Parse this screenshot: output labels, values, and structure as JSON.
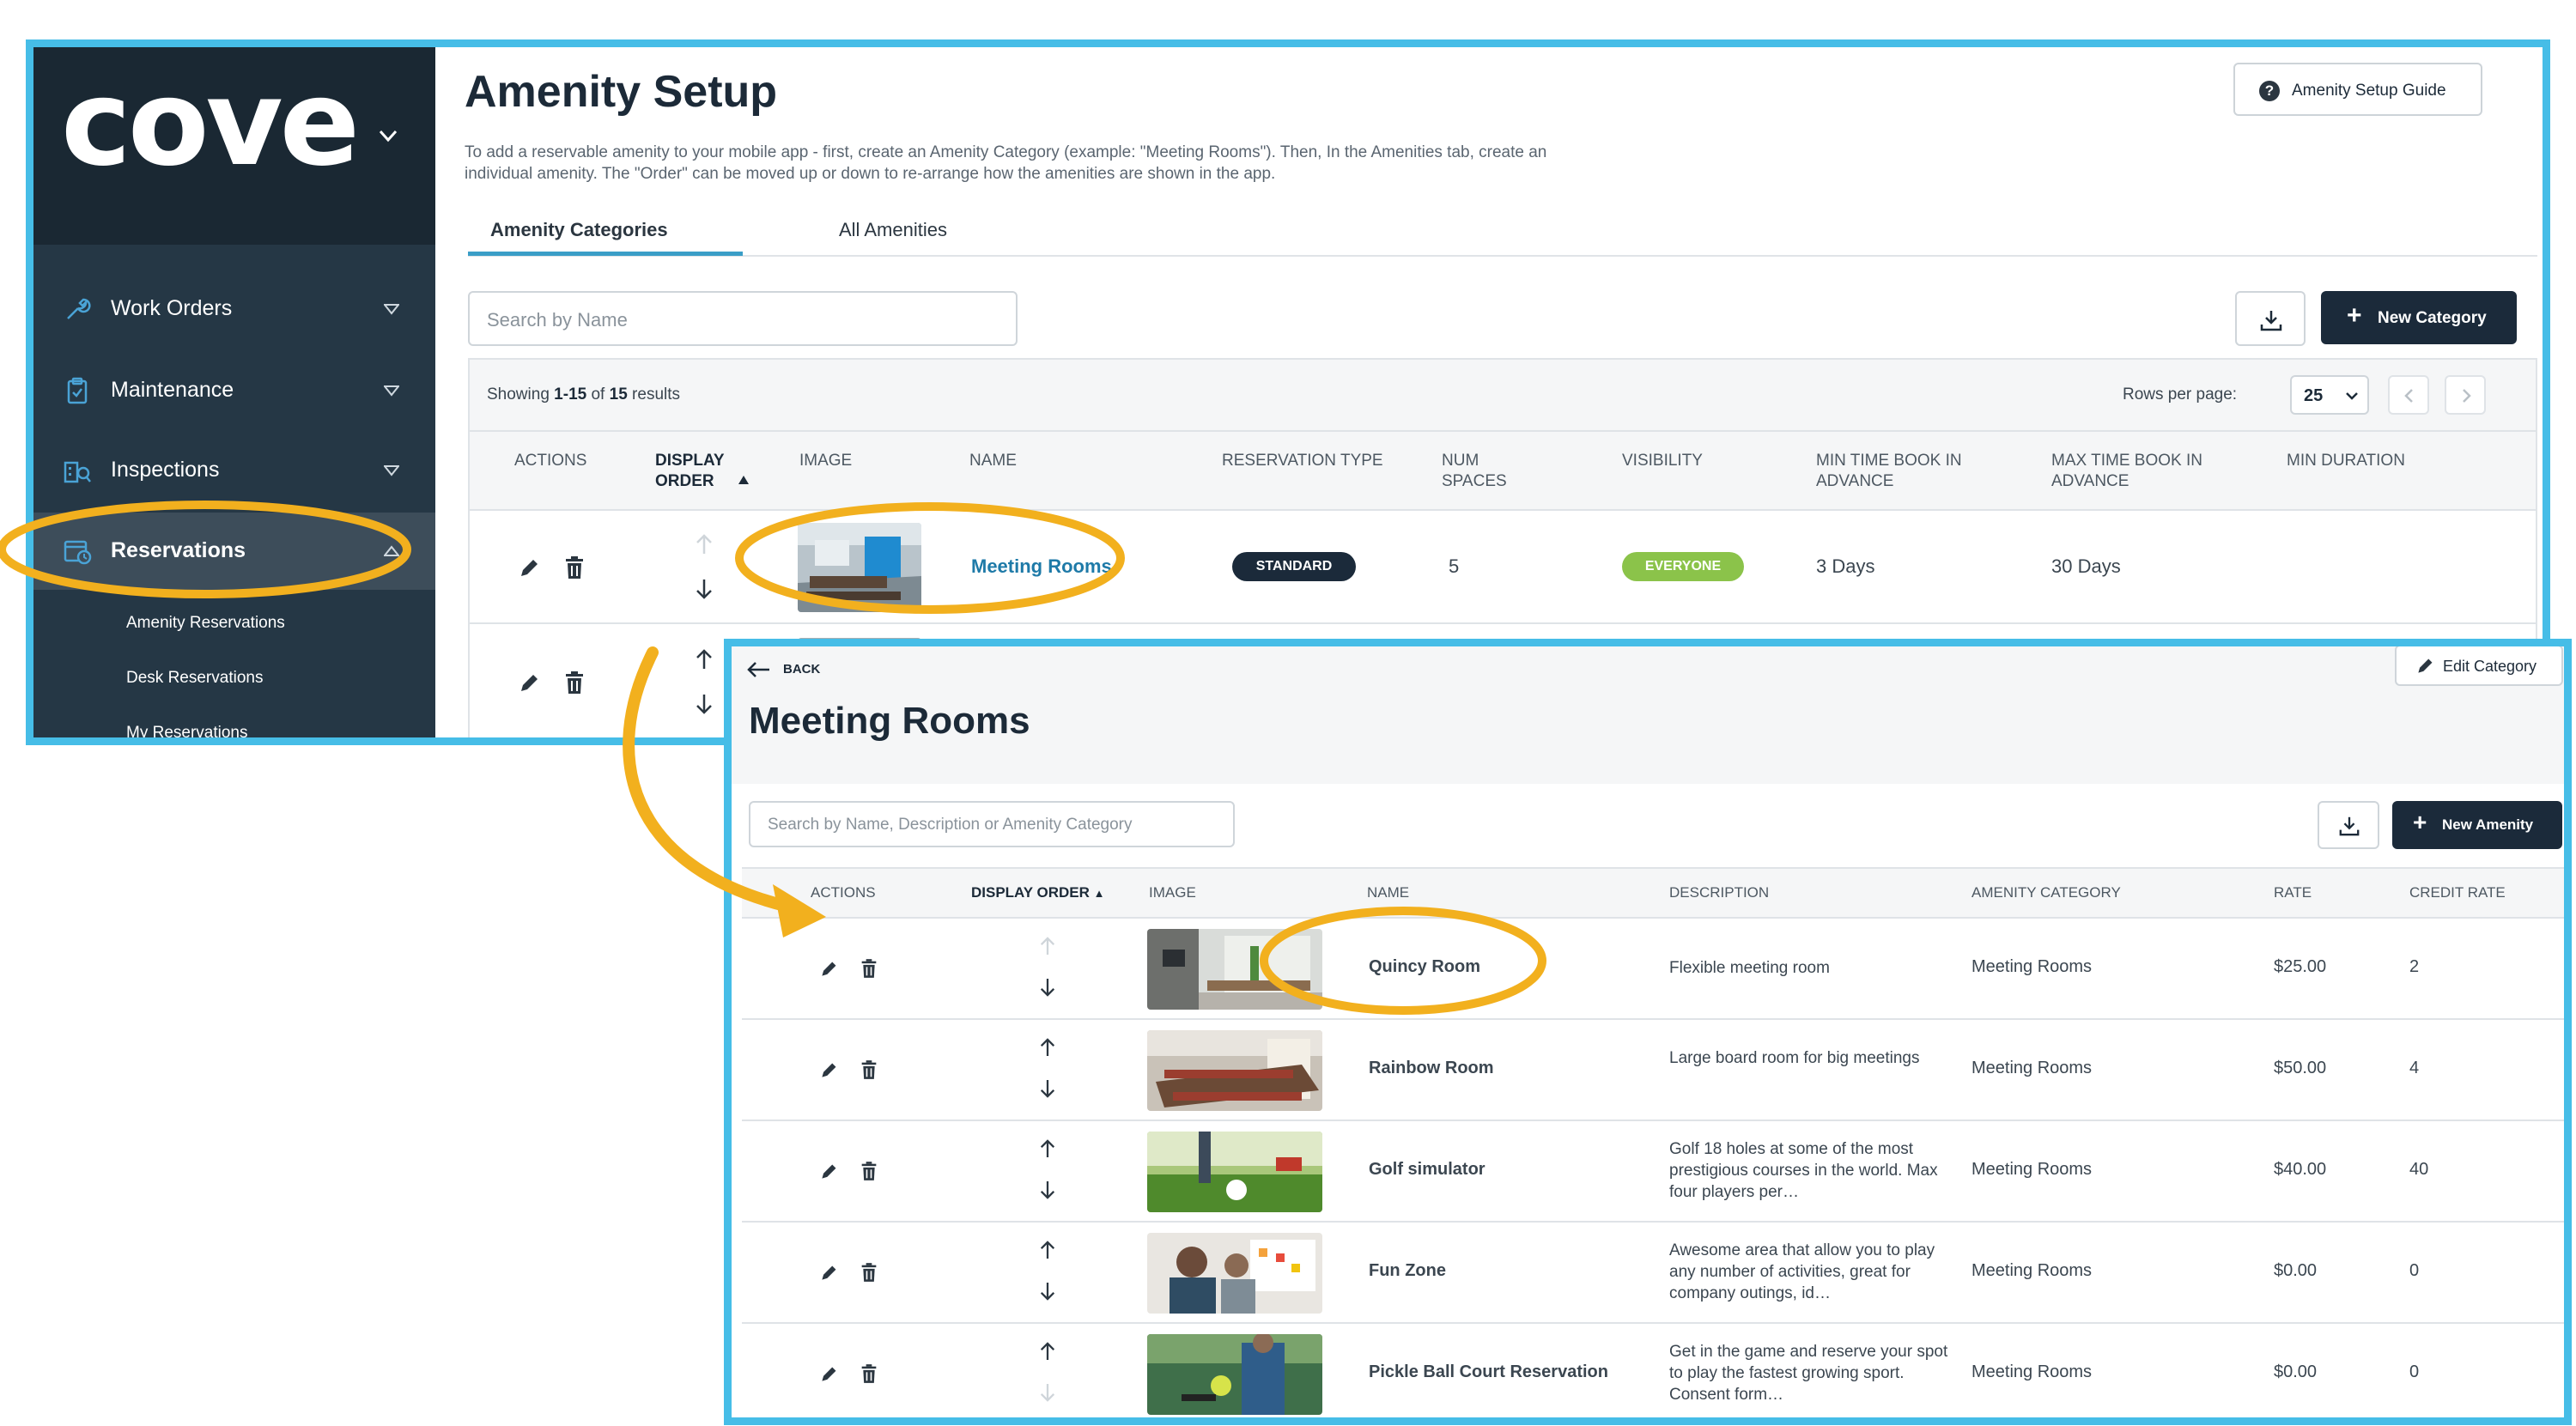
{
  "brand": {
    "logo_text": "cove",
    "accent": "#46bde7",
    "highlight": "#f2b01e",
    "nav_bg": "#253745",
    "primary_btn": "#1b2a3a"
  },
  "sidebar": {
    "items": [
      {
        "label": "Work Orders",
        "icon": "wrench-icon"
      },
      {
        "label": "Maintenance",
        "icon": "clipboard-icon"
      },
      {
        "label": "Inspections",
        "icon": "building-inspect-icon"
      },
      {
        "label": "Reservations",
        "icon": "calendar-clock-icon",
        "active": true
      }
    ],
    "sub_items": [
      "Amenity Reservations",
      "Desk Reservations",
      "My Reservations"
    ]
  },
  "page": {
    "title": "Amenity Setup",
    "intro": "To add a reservable amenity to your mobile app - first, create an Amenity Category (example: \"Meeting Rooms\"). Then, In the Amenities tab, create an individual amenity. The \"Order\" can be moved up or down to re-arrange how the amenities are shown in the app.",
    "guide_button": "Amenity Setup Guide",
    "tabs": [
      "Amenity Categories",
      "All Amenities"
    ],
    "search_placeholder": "Search by Name",
    "new_button": "New Category",
    "showing_prefix": "Showing",
    "showing_range": "1-15",
    "showing_of": "of",
    "showing_total": "15",
    "showing_suffix": "results",
    "rows_per_page_label": "Rows per page:",
    "rows_per_page_value": "25",
    "columns": {
      "actions": "ACTIONS",
      "display_order_1": "DISPLAY",
      "display_order_2": "ORDER",
      "image": "IMAGE",
      "name": "NAME",
      "reservation_type": "RESERVATION TYPE",
      "num_spaces_1": "NUM",
      "num_spaces_2": "SPACES",
      "visibility": "VISIBILITY",
      "min_time_1": "MIN TIME BOOK IN",
      "min_time_2": "ADVANCE",
      "max_time_1": "MAX TIME BOOK IN",
      "max_time_2": "ADVANCE",
      "min_duration": "MIN DURATION"
    },
    "rows": [
      {
        "name": "Meeting Rooms",
        "reservation_type": "STANDARD",
        "num_spaces": "5",
        "visibility": "EVERYONE",
        "min_time": "3 Days",
        "max_time": "30 Days",
        "min_duration": ""
      }
    ]
  },
  "detail": {
    "back_label": "BACK",
    "edit_button": "Edit Category",
    "title": "Meeting Rooms",
    "search_placeholder": "Search by Name, Description or Amenity Category",
    "new_button": "New Amenity",
    "columns": {
      "actions": "ACTIONS",
      "display_order": "DISPLAY ORDER",
      "sort_arrow": "▲",
      "image": "IMAGE",
      "name": "NAME",
      "description": "DESCRIPTION",
      "amenity_category": "AMENITY CATEGORY",
      "rate": "RATE",
      "credit_rate": "CREDIT RATE"
    },
    "rows": [
      {
        "name": "Quincy Room",
        "description": "Flexible meeting room",
        "category": "Meeting Rooms",
        "rate": "$25.00",
        "credit_rate": "2"
      },
      {
        "name": "Rainbow Room",
        "description": "Large board room for big meetings",
        "category": "Meeting Rooms",
        "rate": "$50.00",
        "credit_rate": "4"
      },
      {
        "name": "Golf simulator",
        "description": "Golf 18 holes at some of the most prestigious courses in the world. Max four players per…",
        "category": "Meeting Rooms",
        "rate": "$40.00",
        "credit_rate": "40"
      },
      {
        "name": "Fun Zone",
        "description": "Awesome area that allow you to play any number of activities, great for company outings, id…",
        "category": "Meeting Rooms",
        "rate": "$0.00",
        "credit_rate": "0"
      },
      {
        "name": "Pickle Ball Court Reservation",
        "description": "Get in the game and reserve your spot to play the fastest growing sport. Consent form…",
        "category": "Meeting Rooms",
        "rate": "$0.00",
        "credit_rate": "0"
      }
    ]
  }
}
